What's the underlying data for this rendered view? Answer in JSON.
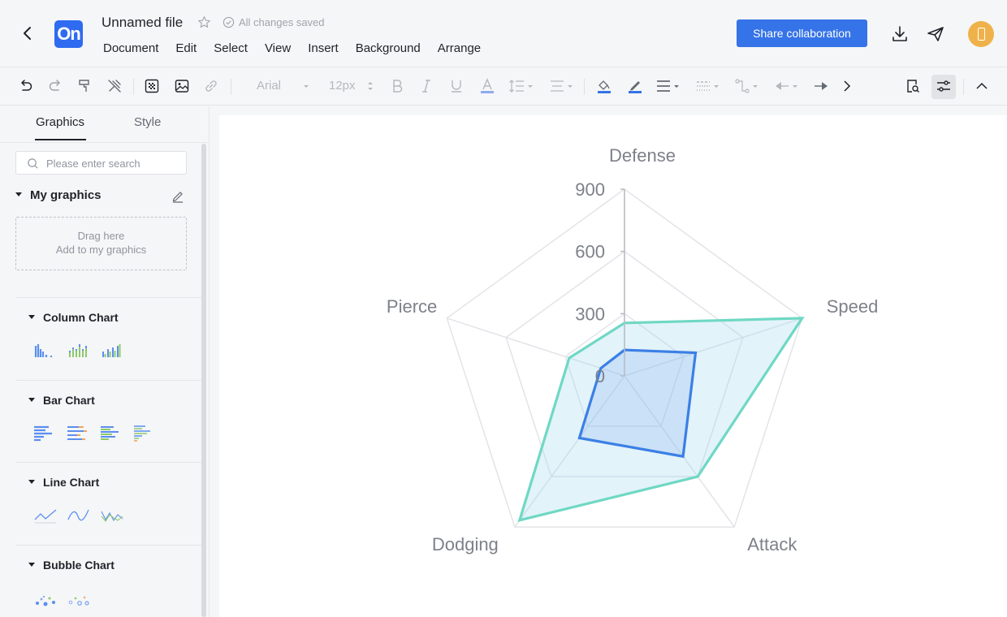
{
  "header": {
    "file_title": "Unnamed file",
    "save_status": "All changes saved",
    "logo_text": "On",
    "menu": [
      "Document",
      "Edit",
      "Select",
      "View",
      "Insert",
      "Background",
      "Arrange"
    ],
    "share_label": "Share collaboration"
  },
  "toolbar": {
    "font_family": "Arial",
    "font_size": "12px"
  },
  "sidebar": {
    "tabs": [
      "Graphics",
      "Style"
    ],
    "search_placeholder": "Please enter search",
    "my_graphics": "My graphics",
    "drop_line1": "Drag here",
    "drop_line2": "Add to my graphics",
    "sections": [
      "Column Chart",
      "Bar Chart",
      "Line Chart",
      "Bubble Chart"
    ]
  },
  "colors": {
    "accent": "#3573e8",
    "series_outer": "#6fd8c4",
    "series_inner": "#3b7fe6"
  },
  "chart_data": {
    "type": "radar",
    "indicators": [
      "Defense",
      "Speed",
      "Attack",
      "Dodging",
      "Pierce"
    ],
    "max": 900,
    "ticks": [
      "0",
      "300",
      "600",
      "900"
    ],
    "series": [
      {
        "values": [
          255,
          900,
          600,
          860,
          280
        ]
      },
      {
        "values": [
          125,
          360,
          480,
          370,
          120
        ]
      }
    ]
  }
}
